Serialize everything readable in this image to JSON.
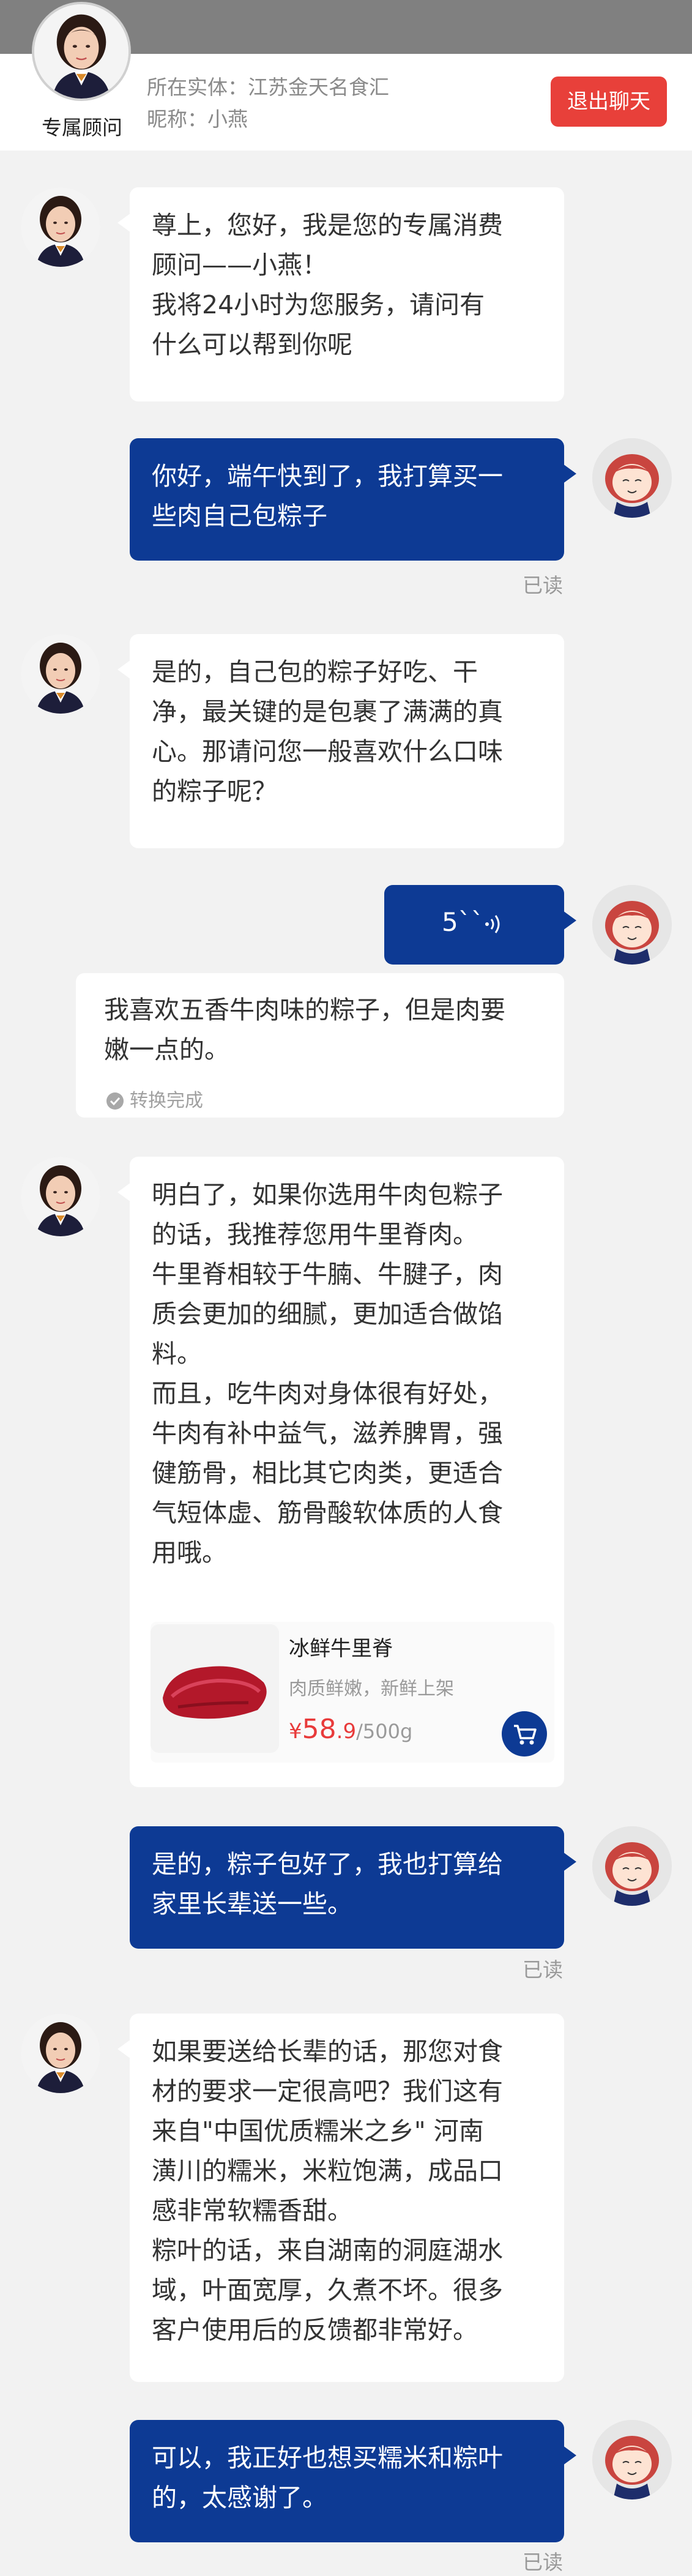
{
  "header": {
    "consultant_label": "专属顾问",
    "entity_label": "所在实体：",
    "entity_value": "江苏金天名食汇",
    "nickname_label": "昵称：",
    "nickname_value": "小燕",
    "exit_button": "退出聊天"
  },
  "messages": [
    {
      "from": "consultant",
      "lines": [
        "尊上，您好，我是您的专属消费",
        "顾问——小燕！",
        "我将24小时为您服务，请问有",
        "什么可以帮到你呢"
      ]
    },
    {
      "from": "user",
      "lines": [
        "你好，端午快到了，我打算买一",
        "些肉自己包粽子"
      ],
      "status": "已读"
    },
    {
      "from": "consultant",
      "lines": [
        "是的，自己包的粽子好吃、干",
        "净，最关键的是包裹了满满的真",
        "心。那请问您一般喜欢什么口味",
        "的粽子呢？"
      ]
    },
    {
      "from": "user",
      "type": "voice",
      "duration": "5``",
      "transcript_lines": [
        "我喜欢五香牛肉味的粽子，但是肉要",
        "嫩一点的。"
      ],
      "transcript_status": "转换完成"
    },
    {
      "from": "consultant",
      "lines": [
        "明白了，如果你选用牛肉包粽子",
        "的话，我推荐您用牛里脊肉。",
        "牛里脊相较于牛腩、牛腱子，肉",
        "质会更加的细腻，更加适合做馅",
        "料。",
        "而且，吃牛肉对身体很有好处，",
        "牛肉有补中益气，滋养脾胃，强",
        "健筋骨，相比其它肉类，更适合",
        "气短体虚、筋骨酸软体质的人食",
        "用哦。"
      ],
      "product": {
        "name": "冰鲜牛里脊",
        "desc": "肉质鲜嫩，新鲜上架",
        "currency": "¥",
        "price_int": "58",
        "price_dec": ".9",
        "unit": "/500g",
        "image": "beef-tenderloin"
      }
    },
    {
      "from": "user",
      "lines": [
        "是的，粽子包好了，我也打算给",
        "家里长辈送一些。"
      ],
      "status": "已读"
    },
    {
      "from": "consultant",
      "lines": [
        "如果要送给长辈的话，那您对食",
        "材的要求一定很高吧？我们这有",
        "来自\"中国优质糯米之乡\" 河南",
        "潢川的糯米，米粒饱满，成品口",
        "感非常软糯香甜。",
        "粽叶的话，来自湖南的洞庭湖水",
        "域，叶面宽厚，久煮不坏。很多",
        "客户使用后的反馈都非常好。"
      ]
    },
    {
      "from": "user",
      "lines": [
        "可以，我正好也想买糯米和粽叶",
        "的，太感谢了。"
      ],
      "status": "已读"
    }
  ],
  "icons": {
    "voice": "voice-wave-icon",
    "check": "check-circle-icon",
    "cart": "cart-icon"
  },
  "colors": {
    "primary": "#0d3a94",
    "danger": "#e8403a",
    "price": "#e83a3a",
    "bg": "#f2f2f2"
  }
}
